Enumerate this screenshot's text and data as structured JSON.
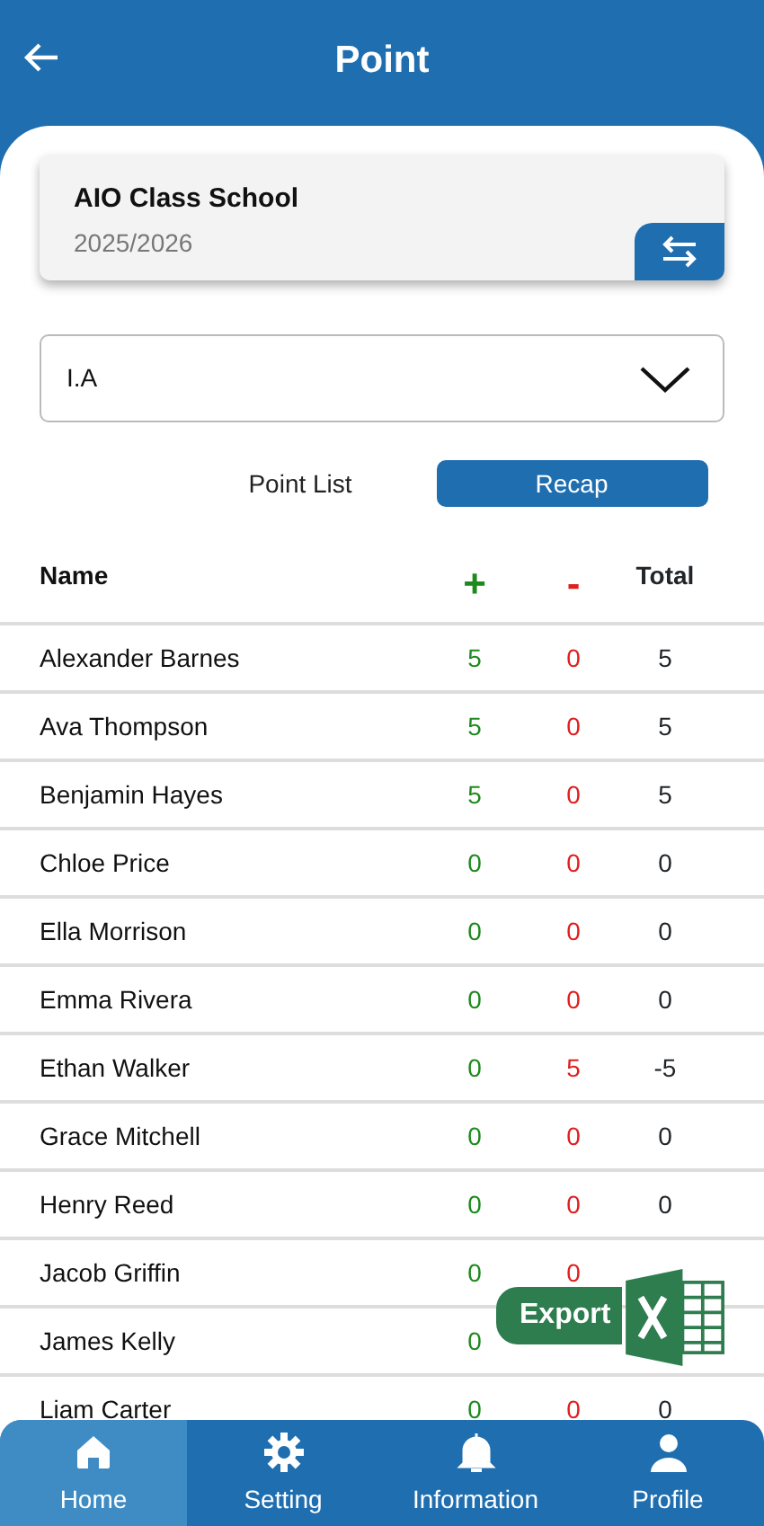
{
  "header": {
    "title": "Point"
  },
  "school": {
    "name": "AIO Class School",
    "year": "2025/2026"
  },
  "class_select": {
    "value": "I.A"
  },
  "tabs": [
    {
      "label": "Point List",
      "selected": false
    },
    {
      "label": "Recap",
      "selected": true
    }
  ],
  "table": {
    "columns": [
      "Name",
      "+",
      "-",
      "Total"
    ],
    "rows": [
      [
        "Alexander Barnes",
        "5",
        "0",
        "5"
      ],
      [
        "Ava Thompson",
        "5",
        "0",
        "5"
      ],
      [
        "Benjamin Hayes",
        "5",
        "0",
        "5"
      ],
      [
        "Chloe Price",
        "0",
        "0",
        "0"
      ],
      [
        "Ella Morrison",
        "0",
        "0",
        "0"
      ],
      [
        "Emma Rivera",
        "0",
        "0",
        "0"
      ],
      [
        "Ethan Walker",
        "0",
        "5",
        "-5"
      ],
      [
        "Grace Mitchell",
        "0",
        "0",
        "0"
      ],
      [
        "Henry Reed",
        "0",
        "0",
        "0"
      ],
      [
        "Jacob Griffin",
        "0",
        "0",
        null
      ],
      [
        "James Kelly",
        "0",
        null,
        null
      ],
      [
        "Liam Carter",
        "0",
        "0",
        "0"
      ]
    ]
  },
  "export_button": {
    "label": "Export"
  },
  "bottom_nav": [
    {
      "label": "Home",
      "selected": true
    },
    {
      "label": "Setting",
      "selected": false
    },
    {
      "label": "Information",
      "selected": false
    },
    {
      "label": "Profile",
      "selected": false
    }
  ]
}
